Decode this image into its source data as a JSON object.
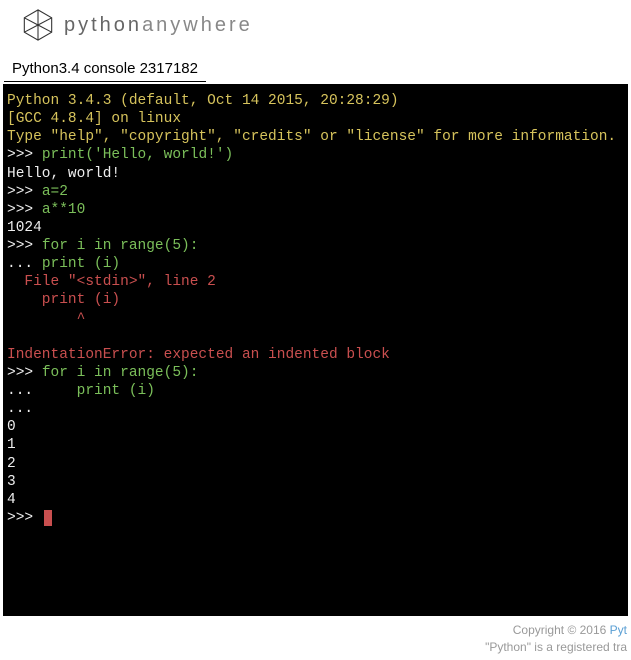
{
  "header": {
    "brand_python": "python",
    "brand_anywhere": "anywhere"
  },
  "console_title": "Python3.4 console 2317182",
  "console": {
    "line_version": "Python 3.4.3 (default, Oct 14 2015, 20:28:29)",
    "line_gcc": "[GCC 4.8.4] on linux",
    "line_help": "Type \"help\", \"copyright\", \"credits\" or \"license\" for more information.",
    "p1": ">>> ",
    "cmd1": "print('Hello, world!')",
    "out1": "Hello, world!",
    "p2": ">>> ",
    "cmd2": "a=2",
    "p3": ">>> ",
    "cmd3": "a**10",
    "out3": "1024",
    "p4": ">>> ",
    "cmd4": "for i in range(5):",
    "p5": "... ",
    "cmd5": "print (i)",
    "err1": "  File \"<stdin>\", line 2",
    "err2": "    print (i)",
    "err3": "        ^",
    "err4": "IndentationError: expected an indented block",
    "p6": ">>> ",
    "cmd6": "for i in range(5):",
    "p7": "... ",
    "cmd7": "    print (i)",
    "p8": "...",
    "loop0": "0",
    "loop1": "1",
    "loop2": "2",
    "loop3": "3",
    "loop4": "4",
    "p9": ">>> "
  },
  "footer": {
    "copyright": "Copyright © 2016 ",
    "link": "Pyt",
    "trademark": "\"Python\" is a registered tra"
  }
}
